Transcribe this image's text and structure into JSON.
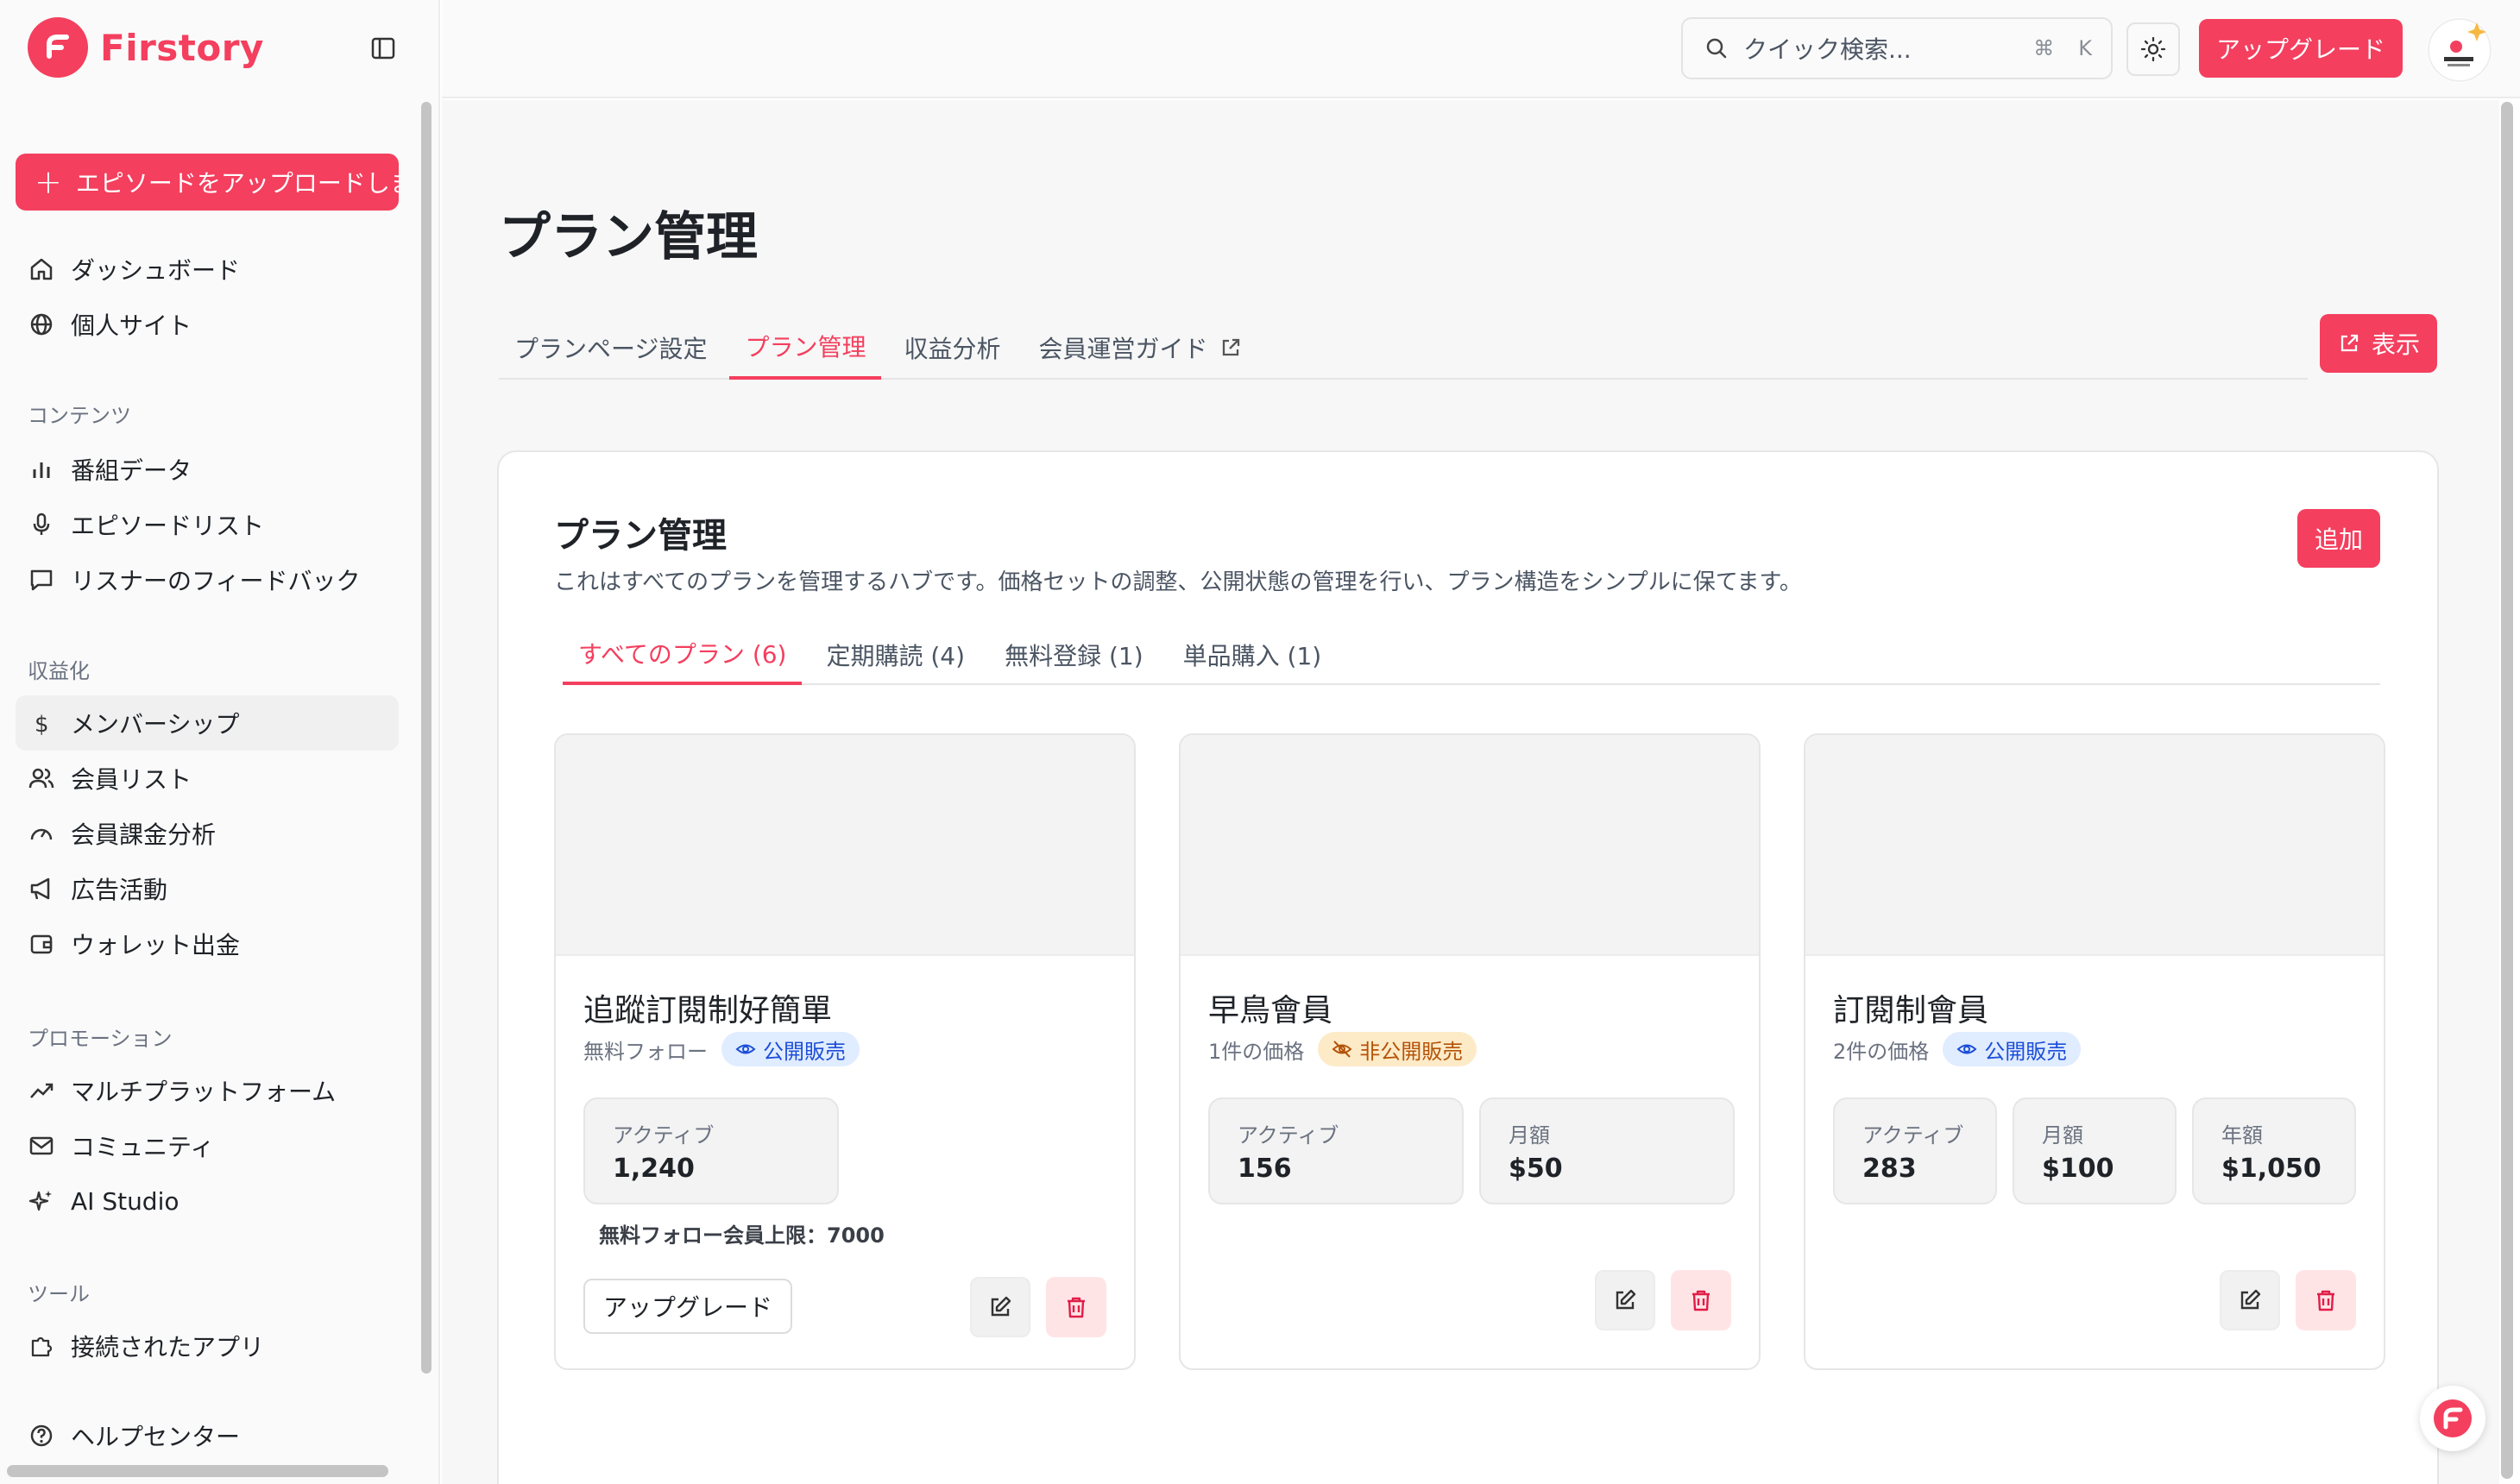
{
  "app": {
    "name": "Firstory"
  },
  "sidebar": {
    "upload_label": "エピソードをアップロードしましょう",
    "top_items": [
      {
        "label": "ダッシュボード",
        "icon": "home-icon"
      },
      {
        "label": "個人サイト",
        "icon": "globe-icon"
      }
    ],
    "sections": [
      {
        "label": "コンテンツ",
        "items": [
          {
            "label": "番組データ",
            "icon": "bar-chart-icon"
          },
          {
            "label": "エピソードリスト",
            "icon": "microphone-icon"
          },
          {
            "label": "リスナーのフィードバック",
            "icon": "message-icon"
          }
        ]
      },
      {
        "label": "収益化",
        "items": [
          {
            "label": "メンバーシップ",
            "icon": "dollar-icon",
            "active": true
          },
          {
            "label": "会員リスト",
            "icon": "users-icon"
          },
          {
            "label": "会員課金分析",
            "icon": "gauge-icon"
          },
          {
            "label": "広告活動",
            "icon": "megaphone-icon"
          },
          {
            "label": "ウォレット出金",
            "icon": "wallet-icon"
          }
        ]
      },
      {
        "label": "プロモーション",
        "items": [
          {
            "label": "マルチプラットフォーム",
            "icon": "trending-icon"
          },
          {
            "label": "コミュニティ",
            "icon": "mail-icon"
          },
          {
            "label": "AI Studio",
            "icon": "sparkles-icon"
          }
        ]
      },
      {
        "label": "ツール",
        "items": [
          {
            "label": "接続されたアプリ",
            "icon": "puzzle-icon"
          }
        ]
      }
    ],
    "help_label": "ヘルプセンター"
  },
  "topbar": {
    "search_placeholder": "クイック検索...",
    "shortcut_cmd": "⌘",
    "shortcut_key": "K",
    "upgrade_label": "アップグレード"
  },
  "main": {
    "title": "プラン管理",
    "tabs": [
      {
        "label": "プランページ設定"
      },
      {
        "label": "プラン管理",
        "active": true
      },
      {
        "label": "収益分析"
      },
      {
        "label": "会員運営ガイド",
        "external": true
      }
    ],
    "view_label": "表示",
    "card": {
      "title": "プラン管理",
      "description": "これはすべてのプランを管理するハブです。価格セットの調整、公開状態の管理を行い、プラン構造をシンプルに保てます。",
      "add_label": "追加",
      "tabs": [
        {
          "label": "すべてのプラン (6)",
          "active": true
        },
        {
          "label": "定期購読 (4)"
        },
        {
          "label": "無料登録 (1)"
        },
        {
          "label": "単品購入 (1)"
        }
      ]
    },
    "plans": [
      {
        "name": "追蹤訂閱制好簡單",
        "meta": "無料フォロー",
        "status": "公開販売",
        "status_type": "public",
        "stats": [
          {
            "label": "アクティブ",
            "value": "1,240"
          }
        ],
        "limit": "無料フォロー会員上限：7000",
        "upgrade_label": "アップグレード"
      },
      {
        "name": "早鳥會員",
        "meta": "1件の価格",
        "status": "非公開販売",
        "status_type": "private",
        "stats": [
          {
            "label": "アクティブ",
            "value": "156"
          },
          {
            "label": "月額",
            "value": "$50"
          }
        ]
      },
      {
        "name": "訂閱制會員",
        "meta": "2件の価格",
        "status": "公開販売",
        "status_type": "public",
        "stats": [
          {
            "label": "アクティブ",
            "value": "283"
          },
          {
            "label": "月額",
            "value": "$100"
          },
          {
            "label": "年額",
            "value": "$1,050"
          }
        ]
      }
    ]
  },
  "colors": {
    "accent": "#f43f5e",
    "public_badge": "#e0ecff",
    "private_badge": "#fdebc8"
  }
}
